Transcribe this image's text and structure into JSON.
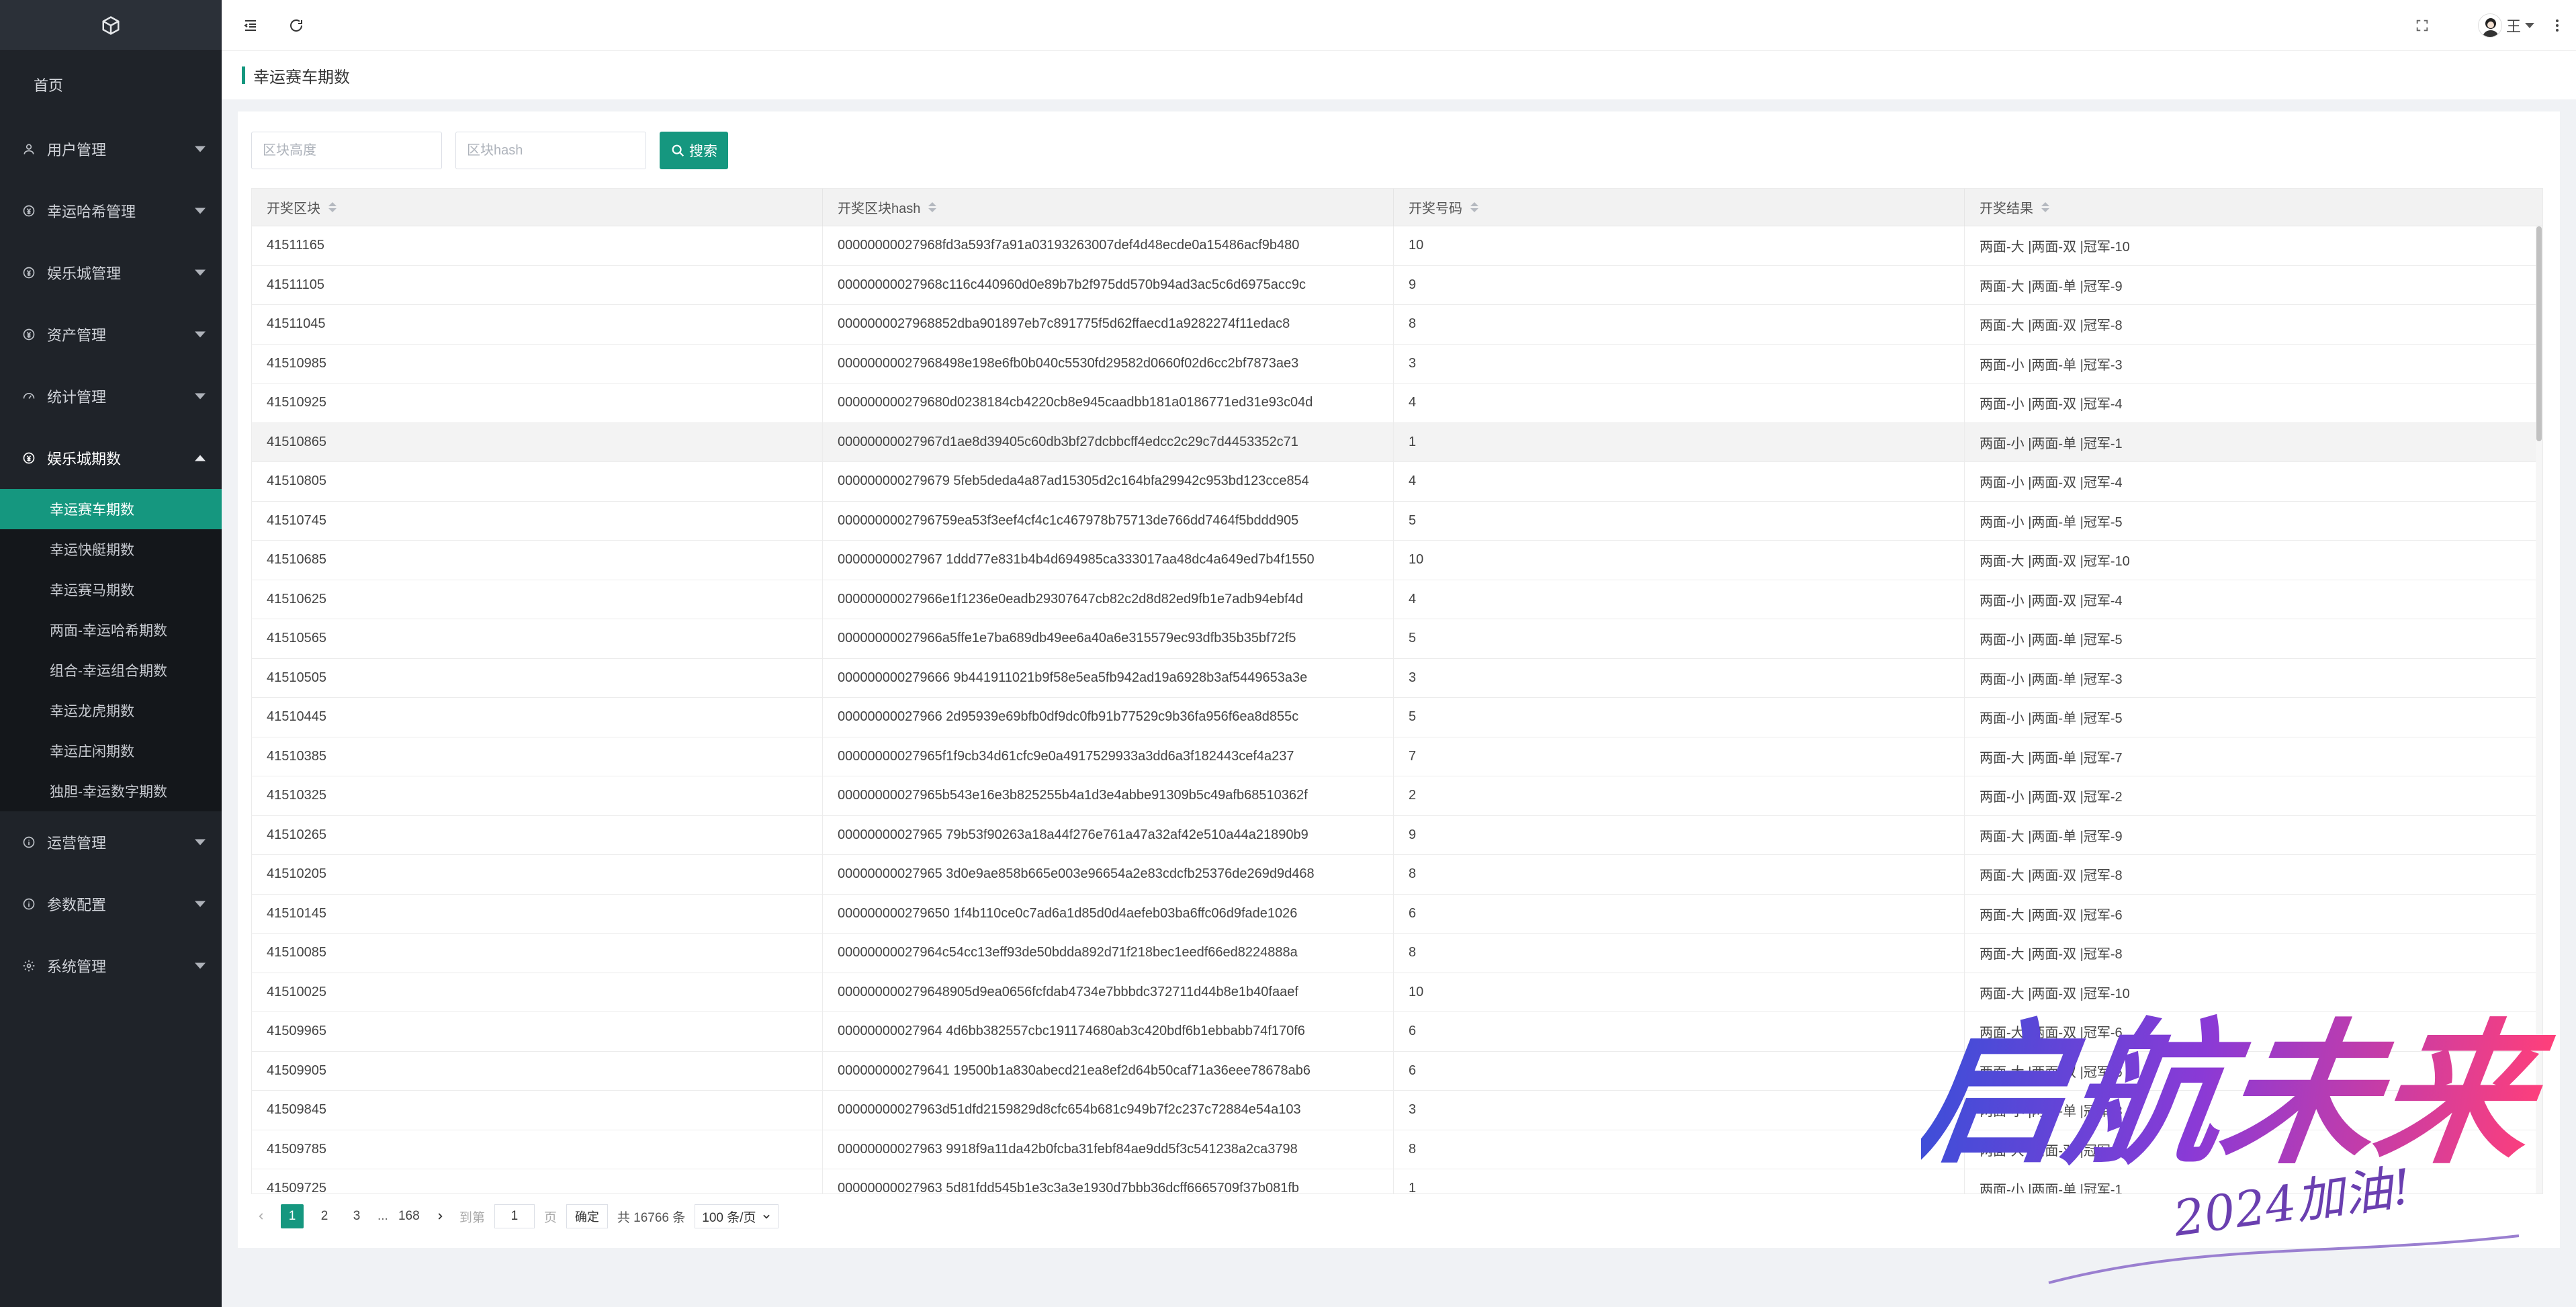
{
  "sidebar": {
    "home": "首页",
    "menus": [
      {
        "label": "用户管理",
        "icon": "user-icon",
        "open": false
      },
      {
        "label": "幸运哈希管理",
        "icon": "circle-dollar-icon",
        "open": false
      },
      {
        "label": "娱乐城管理",
        "icon": "circle-dollar-icon",
        "open": false
      },
      {
        "label": "资产管理",
        "icon": "circle-dollar-icon",
        "open": false
      },
      {
        "label": "统计管理",
        "icon": "dashboard-icon",
        "open": false
      },
      {
        "label": "娱乐城期数",
        "icon": "circle-dollar-icon",
        "open": true
      },
      {
        "label": "运营管理",
        "icon": "info-icon",
        "open": false
      },
      {
        "label": "参数配置",
        "icon": "info-icon",
        "open": false
      },
      {
        "label": "系统管理",
        "icon": "gear-icon",
        "open": false
      }
    ],
    "submenu": [
      {
        "label": "幸运赛车期数",
        "active": true
      },
      {
        "label": "幸运快艇期数",
        "active": false
      },
      {
        "label": "幸运赛马期数",
        "active": false
      },
      {
        "label": "两面-幸运哈希期数",
        "active": false
      },
      {
        "label": "组合-幸运组合期数",
        "active": false
      },
      {
        "label": "幸运龙虎期数",
        "active": false
      },
      {
        "label": "幸运庄闲期数",
        "active": false
      },
      {
        "label": "独胆-幸运数字期数",
        "active": false
      }
    ]
  },
  "topbar": {
    "user": "王"
  },
  "page": {
    "title": "幸运赛车期数"
  },
  "search": {
    "height_placeholder": "区块高度",
    "hash_placeholder": "区块hash",
    "button": "搜索"
  },
  "table": {
    "columns": [
      "开奖区块",
      "开奖区块hash",
      "开奖号码",
      "开奖结果"
    ],
    "rows": [
      [
        "41511165",
        "00000000027968fd3a593f7a91a03193263007def4d48ecde0a15486acf9b480",
        "10",
        "两面-大 |两面-双 |冠军-10"
      ],
      [
        "41511105",
        "00000000027968c116c440960d0e89b7b2f975dd570b94ad3ac5c6d6975acc9c",
        "9",
        "两面-大 |两面-单 |冠军-9"
      ],
      [
        "41511045",
        "0000000027968852dba901897eb7c891775f5d62ffaecd1a9282274f11edac8",
        "8",
        "两面-大 |两面-双 |冠军-8"
      ],
      [
        "41510985",
        "00000000027968498e198e6fb0b040c5530fd29582d0660f02d6cc2bf7873ae3",
        "3",
        "两面-小 |两面-单 |冠军-3"
      ],
      [
        "41510925",
        "000000000279680d0238184cb4220cb8e945caadbb181a0186771ed31e93c04d",
        "4",
        "两面-小 |两面-双 |冠军-4"
      ],
      [
        "41510865",
        "00000000027967d1ae8d39405c60db3bf27dcbbcff4edcc2c29c7d4453352c71",
        "1",
        "两面-小 |两面-单 |冠军-1"
      ],
      [
        "41510805",
        "000000000279679 5feb5deda4a87ad15305d2c164bfa29942c953bd123cce854",
        "4",
        "两面-小 |两面-双 |冠军-4"
      ],
      [
        "41510745",
        "0000000002796759ea53f3eef4cf4c1c467978b75713de766dd7464f5bddd905",
        "5",
        "两面-小 |两面-单 |冠军-5"
      ],
      [
        "41510685",
        "00000000027967 1ddd77e831b4b4d694985ca333017aa48dc4a649ed7b4f1550",
        "10",
        "两面-大 |两面-双 |冠军-10"
      ],
      [
        "41510625",
        "00000000027966e1f1236e0eadb29307647cb82c2d8d82ed9fb1e7adb94ebf4d",
        "4",
        "两面-小 |两面-双 |冠军-4"
      ],
      [
        "41510565",
        "00000000027966a5ffe1e7ba689db49ee6a40a6e315579ec93dfb35b35bf72f5",
        "5",
        "两面-小 |两面-单 |冠军-5"
      ],
      [
        "41510505",
        "000000000279666 9b441911021b9f58e5ea5fb942ad19a6928b3af5449653a3e",
        "3",
        "两面-小 |两面-单 |冠军-3"
      ],
      [
        "41510445",
        "00000000027966 2d95939e69bfb0df9dc0fb91b77529c9b36fa956f6ea8d855c",
        "5",
        "两面-小 |两面-单 |冠军-5"
      ],
      [
        "41510385",
        "00000000027965f1f9cb34d61cfc9e0a4917529933a3dd6a3f182443cef4a237",
        "7",
        "两面-大 |两面-单 |冠军-7"
      ],
      [
        "41510325",
        "00000000027965b543e16e3b825255b4a1d3e4abbe91309b5c49afb68510362f",
        "2",
        "两面-小 |两面-双 |冠军-2"
      ],
      [
        "41510265",
        "00000000027965 79b53f90263a18a44f276e761a47a32af42e510a44a21890b9",
        "9",
        "两面-大 |两面-单 |冠军-9"
      ],
      [
        "41510205",
        "00000000027965 3d0e9ae858b665e003e96654a2e83cdcfb25376de269d9d468",
        "8",
        "两面-大 |两面-双 |冠军-8"
      ],
      [
        "41510145",
        "000000000279650 1f4b110ce0c7ad6a1d85d0d4aefeb03ba6ffc06d9fade1026",
        "6",
        "两面-大 |两面-双 |冠军-6"
      ],
      [
        "41510085",
        "00000000027964c54cc13eff93de50bdda892d71f218bec1eedf66ed8224888a",
        "8",
        "两面-大 |两面-双 |冠军-8"
      ],
      [
        "41510025",
        "000000000279648905d9ea0656fcfdab4734e7bbbdc372711d44b8e1b40faaef",
        "10",
        "两面-大 |两面-双 |冠军-10"
      ],
      [
        "41509965",
        "00000000027964 4d6bb382557cbc191174680ab3c420bdf6b1ebbabb74f170f6",
        "6",
        "两面-大 |两面-双 |冠军-6"
      ],
      [
        "41509905",
        "000000000279641 19500b1a830abecd21ea8ef2d64b50caf71a36eee78678ab6",
        "6",
        "两面-大 |两面-双 |冠军-6"
      ],
      [
        "41509845",
        "00000000027963d51dfd2159829d8cfc654b681c949b7f2c237c72884e54a103",
        "3",
        "两面-小 |两面-单 |冠军-3"
      ],
      [
        "41509785",
        "00000000027963 9918f9a11da42b0fcba31febf84ae9dd5f3c541238a2ca3798",
        "8",
        "两面-大 |两面-双 |冠军-8"
      ],
      [
        "41509725",
        "00000000027963 5d81fdd545b1e3c3a3e1930d7bbb36dcff6665709f37b081fb",
        "1",
        "两面-小 |两面-单 |冠军-1"
      ]
    ]
  },
  "pagination": {
    "pages": [
      "1",
      "2",
      "3"
    ],
    "ellipsis": "...",
    "last_page": "168",
    "goto_label": "到第",
    "goto_value": "1",
    "page_unit": "页",
    "confirm": "确定",
    "total": "共 16766 条",
    "page_size": "100 条/页"
  },
  "watermark": {
    "main": "启航未来",
    "sub": "2024加油!"
  }
}
